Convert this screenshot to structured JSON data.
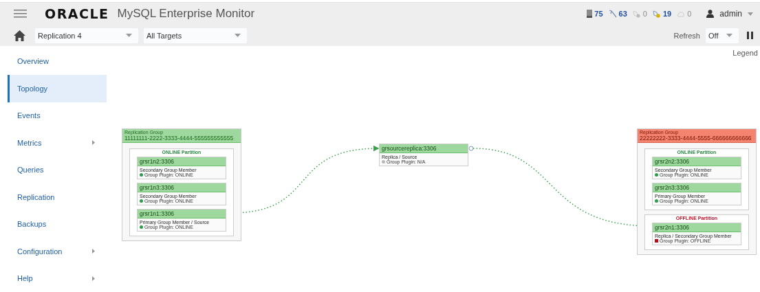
{
  "header": {
    "logo": "ORACLE",
    "product": "MySQL Enterprise Monitor",
    "counters": [
      {
        "kind": "server",
        "count": "75",
        "active": true
      },
      {
        "kind": "instance",
        "count": "63",
        "active": true
      },
      {
        "kind": "info",
        "count": "0",
        "active": false
      },
      {
        "kind": "warning",
        "count": "19",
        "active": true
      },
      {
        "kind": "cloud",
        "count": "0",
        "active": false
      }
    ],
    "user": "admin"
  },
  "toolbar": {
    "group_select": "Replication 4",
    "target_select": "All Targets",
    "refresh_label": "Refresh",
    "refresh_select": "Off"
  },
  "sidebar": {
    "items": [
      {
        "label": "Overview",
        "selected": false,
        "submenu": false
      },
      {
        "label": "Topology",
        "selected": true,
        "submenu": false
      },
      {
        "label": "Events",
        "selected": false,
        "submenu": false
      },
      {
        "label": "Metrics",
        "selected": false,
        "submenu": true
      },
      {
        "label": "Queries",
        "selected": false,
        "submenu": false
      },
      {
        "label": "Replication",
        "selected": false,
        "submenu": false
      },
      {
        "label": "Backups",
        "selected": false,
        "submenu": false
      },
      {
        "label": "Configuration",
        "selected": false,
        "submenu": true
      },
      {
        "label": "Help",
        "selected": false,
        "submenu": true
      }
    ]
  },
  "topology": {
    "legend": "Legend",
    "groups": [
      {
        "caption": "Replication Group",
        "id_text": "11111111-2222-3333-4444-555555555555",
        "alert": false,
        "partitions": [
          {
            "label": "ONLINE Partition",
            "offline": false,
            "nodes": [
              {
                "name": "grsr1n2:3306",
                "role": "Secondary Group Member",
                "plugin": "Group Plugin: ONLINE",
                "color": "#2e9b4f",
                "offline": false
              },
              {
                "name": "grsr1n3:3306",
                "role": "Secondary Group Member",
                "plugin": "Group Plugin: ONLINE",
                "color": "#2e9b4f",
                "offline": false
              },
              {
                "name": "grsr1n1:3306",
                "role": "Primary Group Member / Source",
                "plugin": "Group Plugin: ONLINE",
                "color": "#2e9b4f",
                "offline": false
              }
            ]
          }
        ]
      },
      {
        "caption": "Replication Group",
        "id_text": "22222222-3333-4444-5555-666666666666",
        "alert": true,
        "partitions": [
          {
            "label": "ONLINE Partition",
            "offline": false,
            "nodes": [
              {
                "name": "grsr2n2:3306",
                "role": "Secondary Group Member",
                "plugin": "Group Plugin: ONLINE",
                "color": "#2e9b4f",
                "offline": false
              },
              {
                "name": "grsr2n3:3306",
                "role": "Primary Group Member",
                "plugin": "Group Plugin: ONLINE",
                "color": "#2e9b4f",
                "offline": false
              }
            ]
          },
          {
            "label": "OFFLINE Partition",
            "offline": true,
            "nodes": [
              {
                "name": "grsr2n1:3306",
                "role": "Replica / Secondary Group Member",
                "plugin": "Group Plugin: OFFLINE",
                "color": "#b0101c",
                "offline": true
              }
            ]
          }
        ]
      }
    ],
    "standalone": {
      "name": "grsourcereplica:3306",
      "role": "Replica / Source",
      "plugin": "Group Plugin: N/A",
      "color": "#b9b9b9",
      "offline": false
    }
  }
}
